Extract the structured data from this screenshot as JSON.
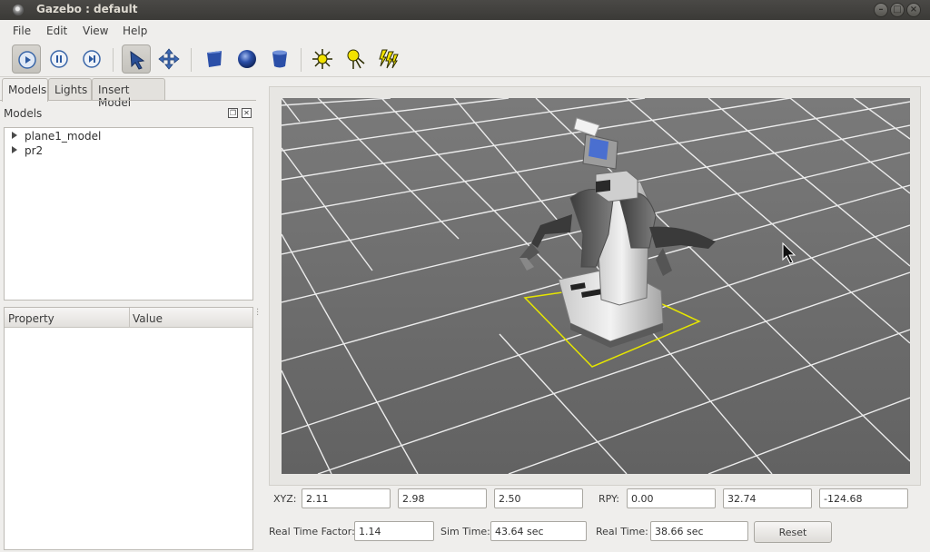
{
  "window": {
    "title": "Gazebo : default"
  },
  "menu": {
    "file": "File",
    "edit": "Edit",
    "view": "View",
    "help": "Help"
  },
  "toolbar": {
    "buttons": [
      "play-icon",
      "pause-icon",
      "step-icon",
      "select-arrow-icon",
      "translate-icon",
      "box-icon",
      "sphere-icon",
      "cylinder-icon",
      "point-light-icon",
      "spot-light-icon",
      "directional-light-icon"
    ],
    "colors": {
      "shape_blue": "#2b4fa8",
      "light_yellow": "#f2e200"
    }
  },
  "tabs": [
    "Models",
    "Lights",
    "Insert Model"
  ],
  "models_panel": {
    "header": "Models",
    "items": [
      "plane1_model",
      "pr2"
    ]
  },
  "property_table": {
    "columns": [
      "Property",
      "Value"
    ]
  },
  "pose": {
    "xyz_label": "XYZ:",
    "x": "2.11",
    "y": "2.98",
    "z": "2.50",
    "rpy_label": "RPY:",
    "roll": "0.00",
    "pitch": "32.74",
    "yaw": "-124.68"
  },
  "status": {
    "rtf_label": "Real Time Factor:",
    "rtf": "1.14",
    "sim_label": "Sim Time:",
    "sim": "43.64 sec",
    "real_label": "Real Time:",
    "real": "38.66 sec",
    "reset_label": "Reset"
  },
  "scene": {
    "ground_color": "#6d6d6d",
    "grid_color": "#e8e8e8",
    "selection_color": "#e6e600"
  }
}
